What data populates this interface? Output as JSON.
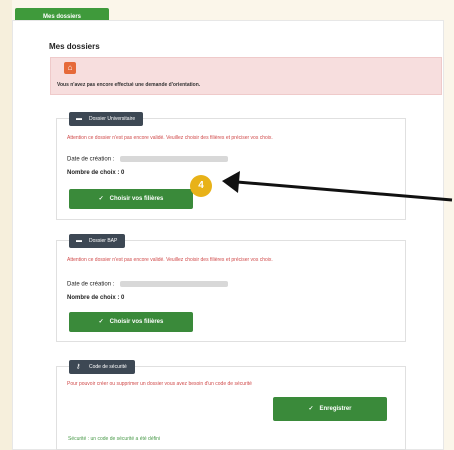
{
  "top_tab": {
    "label": "Mes dossiers"
  },
  "page": {
    "title": "Mes dossiers"
  },
  "alert": {
    "icon": "home-icon",
    "text": "Vous n'avez pas encore effectué une demande d'orientation."
  },
  "cards": [
    {
      "tag": "Dossier Universitaire",
      "tag_icon": "folder-icon",
      "warning": "Attention ce dossier n'est pas encore validé. Veuillez choisir des filières et préciser vos choix.",
      "date_label": "Date de création :",
      "count_label": "Nombre de choix : 0",
      "button": "Choisir vos filières"
    },
    {
      "tag": "Dossier BAP",
      "tag_icon": "folder-icon",
      "warning": "Attention ce dossier n'est pas encore validé. Veuillez choisir des filières et préciser vos choix.",
      "date_label": "Date de création :",
      "count_label": "Nombre de choix : 0",
      "button": "Choisir vos filières"
    },
    {
      "tag": "Code de sécurité",
      "tag_icon": "key-icon",
      "warning": "Pour pouvoir créer ou supprimer un dossier vous avez besoin d'un code de sécurité",
      "button": "Enregistrer"
    }
  ],
  "annotation": {
    "badge": "4"
  },
  "footnote": "Sécurité : un code de sécurité a été défini"
}
